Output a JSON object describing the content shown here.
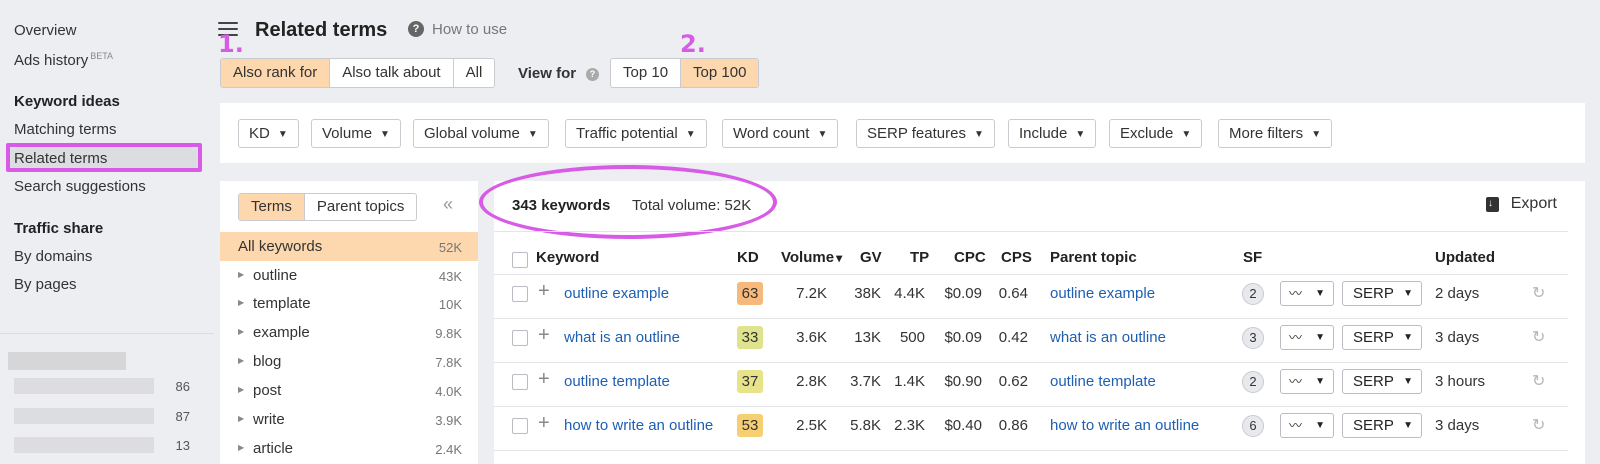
{
  "nav": {
    "overview": "Overview",
    "ads_history": "Ads history",
    "ads_history_badge": "BETA",
    "keyword_ideas_heading": "Keyword ideas",
    "matching_terms": "Matching terms",
    "related_terms": "Related terms",
    "search_suggestions": "Search suggestions",
    "traffic_share_heading": "Traffic share",
    "by_domains": "By domains",
    "by_pages": "By pages",
    "blurred_counts": [
      "86",
      "87",
      "13"
    ]
  },
  "header": {
    "title": "Related terms",
    "how_to_use": "How to use",
    "annotation_1": "1.",
    "annotation_2": "2.",
    "mode_tabs": [
      "Also rank for",
      "Also talk about",
      "All"
    ],
    "view_for_label": "View for",
    "view_for_tabs": [
      "Top 10",
      "Top 100"
    ]
  },
  "filters": [
    "KD",
    "Volume",
    "Global volume",
    "Traffic potential",
    "Word count",
    "SERP features",
    "Include",
    "Exclude",
    "More filters"
  ],
  "terms_panel": {
    "tabs": [
      "Terms",
      "Parent topics"
    ],
    "items": [
      {
        "label": "All keywords",
        "count": "52K"
      },
      {
        "label": "outline",
        "count": "43K"
      },
      {
        "label": "template",
        "count": "10K"
      },
      {
        "label": "example",
        "count": "9.8K"
      },
      {
        "label": "blog",
        "count": "7.8K"
      },
      {
        "label": "post",
        "count": "4.0K"
      },
      {
        "label": "write",
        "count": "3.9K"
      },
      {
        "label": "article",
        "count": "2.4K"
      }
    ]
  },
  "results": {
    "keyword_count": "343 keywords",
    "total_volume": "Total volume: 52K",
    "export_label": "Export"
  },
  "table": {
    "headers": {
      "keyword": "Keyword",
      "kd": "KD",
      "volume": "Volume",
      "gv": "GV",
      "tp": "TP",
      "cpc": "CPC",
      "cps": "CPS",
      "parent_topic": "Parent topic",
      "sf": "SF",
      "updated": "Updated"
    },
    "volume_sort_icon": "▾",
    "rows": [
      {
        "keyword": "outline example",
        "kd": "63",
        "kd_color": "#f6b87b",
        "volume": "7.2K",
        "gv": "38K",
        "tp": "4.4K",
        "cpc": "$0.09",
        "cps": "0.64",
        "parent_topic": "outline example",
        "sf": "2",
        "serp": "SERP",
        "updated": "2 days"
      },
      {
        "keyword": "what is an outline",
        "kd": "33",
        "kd_color": "#dfe38e",
        "volume": "3.6K",
        "gv": "13K",
        "tp": "500",
        "cpc": "$0.09",
        "cps": "0.42",
        "parent_topic": "what is an outline",
        "sf": "3",
        "serp": "SERP",
        "updated": "3 days"
      },
      {
        "keyword": "outline template",
        "kd": "37",
        "kd_color": "#e6e38a",
        "volume": "2.8K",
        "gv": "3.7K",
        "tp": "1.4K",
        "cpc": "$0.90",
        "cps": "0.62",
        "parent_topic": "outline template",
        "sf": "2",
        "serp": "SERP",
        "updated": "3 hours"
      },
      {
        "keyword": "how to write an outline",
        "kd": "53",
        "kd_color": "#f7cf73",
        "volume": "2.5K",
        "gv": "5.8K",
        "tp": "2.3K",
        "cpc": "$0.40",
        "cps": "0.86",
        "parent_topic": "how to write an outline",
        "sf": "6",
        "serp": "SERP",
        "updated": "3 days"
      }
    ]
  },
  "colors": {
    "accent_highlight": "#fdd7ad",
    "annotation": "#d75be6",
    "link": "#1e5fb3"
  },
  "icons": {
    "menu": "menu-icon",
    "help": "help-icon",
    "collapse": "double-chevron-left-icon",
    "export": "download-icon",
    "trend": "trend-chart-icon",
    "refresh": "refresh-icon",
    "plus": "plus-icon"
  }
}
